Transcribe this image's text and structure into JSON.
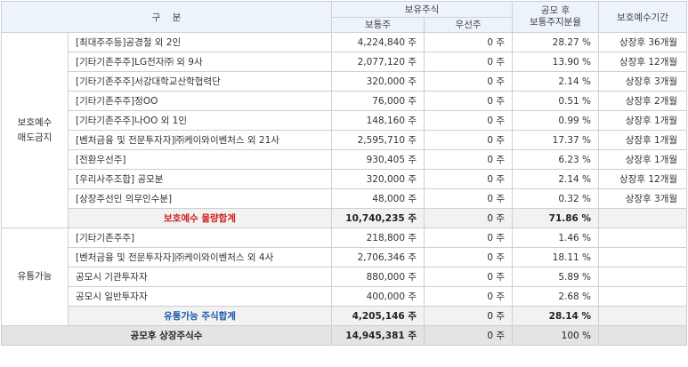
{
  "headers": {
    "category": "구    분",
    "holdings": "보유주식",
    "common": "보통주",
    "preferred": "우선주",
    "ratio_line1": "공모 후",
    "ratio_line2": "보통주지분율",
    "lockup": "보호예수기간"
  },
  "groups": [
    {
      "label_line1": "보호예수",
      "label_line2": "매도금지",
      "rows": [
        {
          "name": "[최대주주등]공경철 외 2인",
          "common": "4,224,840 주",
          "preferred": "0 주",
          "ratio": "28.27 %",
          "lockup": "상장후 36개월"
        },
        {
          "name": "[기타기존주주]LG전자㈜ 외 9사",
          "common": "2,077,120 주",
          "preferred": "0 주",
          "ratio": "13.90 %",
          "lockup": "상장후 12개월"
        },
        {
          "name": "[기타기존주주]서강대학교산학협력단",
          "common": "320,000 주",
          "preferred": "0 주",
          "ratio": "2.14 %",
          "lockup": "상장후 3개월"
        },
        {
          "name": "[기타기존주주]정OO",
          "common": "76,000 주",
          "preferred": "0 주",
          "ratio": "0.51 %",
          "lockup": "상장후 2개월"
        },
        {
          "name": "[기타기존주주]나OO 외 1인",
          "common": "148,160 주",
          "preferred": "0 주",
          "ratio": "0.99 %",
          "lockup": "상장후 1개월"
        },
        {
          "name": "[벤처금융 및 전문투자자]㈜케이와이벤처스 외 21사",
          "common": "2,595,710 주",
          "preferred": "0 주",
          "ratio": "17.37 %",
          "lockup": "상장후 1개월"
        },
        {
          "name": "[전환우선주]",
          "common": "930,405 주",
          "preferred": "0 주",
          "ratio": "6.23 %",
          "lockup": "상장후 1개월"
        },
        {
          "name": "[우리사주조합] 공모분",
          "common": "320,000 주",
          "preferred": "0 주",
          "ratio": "2.14 %",
          "lockup": "상장후 12개월"
        },
        {
          "name": "[상장주선인 의무인수분]",
          "common": "48,000 주",
          "preferred": "0 주",
          "ratio": "0.32 %",
          "lockup": "상장후 3개월"
        }
      ],
      "subtotal": {
        "label": "보호예수 물량합계",
        "common": "10,740,235 주",
        "preferred": "0 주",
        "ratio": "71.86 %"
      }
    },
    {
      "label_line1": "유통가능",
      "label_line2": "",
      "rows": [
        {
          "name": "[기타기존주주]",
          "common": "218,800 주",
          "preferred": "0 주",
          "ratio": "1.46 %",
          "lockup": ""
        },
        {
          "name": "[벤처금융 및 전문투자자]㈜케이와이벤처스 외 4사",
          "common": "2,706,346 주",
          "preferred": "0 주",
          "ratio": "18.11 %",
          "lockup": ""
        },
        {
          "name": "공모시 기관투자자",
          "common": "880,000 주",
          "preferred": "0 주",
          "ratio": "5.89 %",
          "lockup": ""
        },
        {
          "name": "공모시 일반투자자",
          "common": "400,000 주",
          "preferred": "0 주",
          "ratio": "2.68 %",
          "lockup": ""
        }
      ],
      "subtotal": {
        "label": "유통가능 주식합계",
        "common": "4,205,146 주",
        "preferred": "0 주",
        "ratio": "28.14 %"
      }
    }
  ],
  "total": {
    "label": "공모후 상장주식수",
    "common": "14,945,381 주",
    "preferred": "0 주",
    "ratio": "100 %"
  },
  "colors": {
    "subtotal_red": "#d0201d",
    "subtotal_blue": "#1a57a8",
    "header_bg": "#edf3fa"
  }
}
